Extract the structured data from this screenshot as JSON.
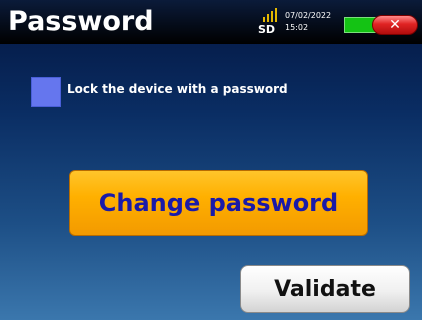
{
  "header": {
    "title": "Password",
    "sd_label": "SD",
    "date": "07/02/2022",
    "time": "15:02",
    "close_icon": "close-icon",
    "signal_icon": "signal-icon",
    "battery_icon": "battery-icon"
  },
  "lock": {
    "label": "Lock the device with a password",
    "checked": false
  },
  "buttons": {
    "change_password": "Change password",
    "validate": "Validate"
  },
  "colors": {
    "accent_orange": "#ffb000",
    "checkbox_blue": "#6576ee",
    "battery_green": "#14c314",
    "close_red": "#e02323"
  }
}
